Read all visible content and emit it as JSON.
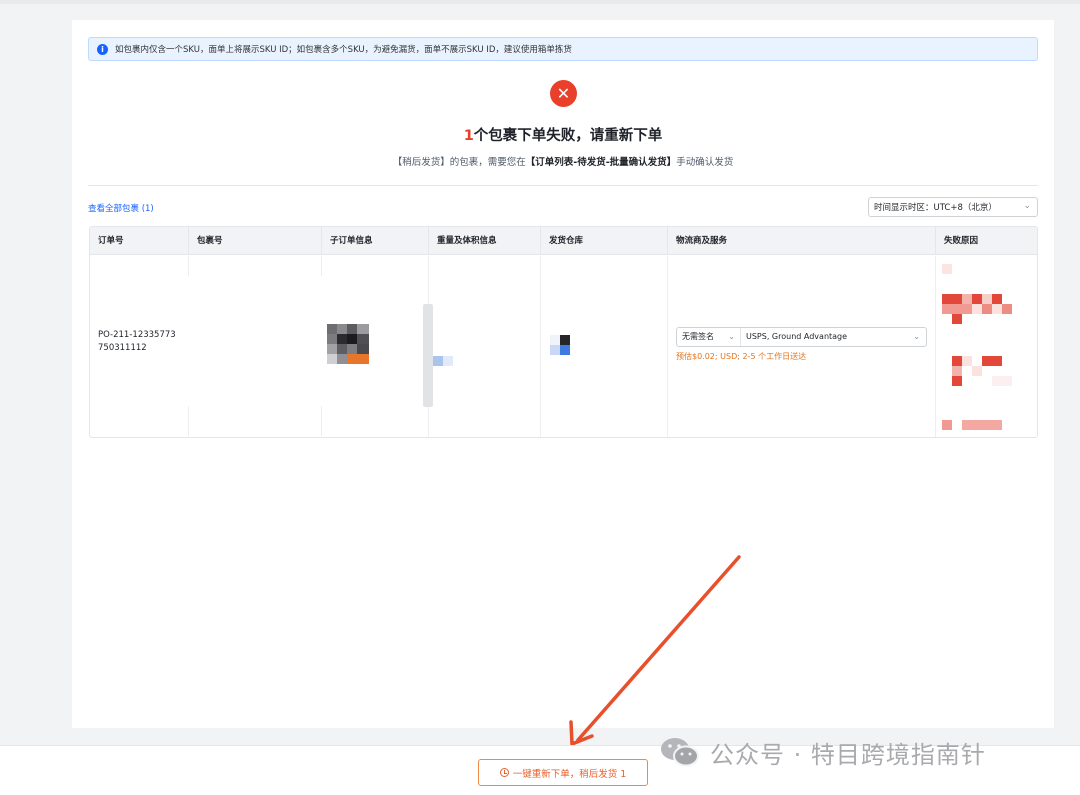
{
  "notice": {
    "text": "如包裹内仅含一个SKU，面单上将展示SKU ID；如包裹含多个SKU，为避免漏货，面单不展示SKU ID，建议使用箱单拣货"
  },
  "result": {
    "count": "1",
    "title_rest": "个包裹下单失败，请重新下单",
    "subtitle_pre": "【稍后发货】的包裹，需要您在",
    "subtitle_bold": "【订单列表-待发货-批量确认发货】",
    "subtitle_post": "手动确认发货"
  },
  "toolbar": {
    "view_all": "查看全部包裹 (1)",
    "timezone": "时间显示时区：UTC+8（北京）"
  },
  "table": {
    "headers": [
      "订单号",
      "包裹号",
      "子订单信息",
      "重量及体积信息",
      "发货仓库",
      "物流商及服务",
      "失败原因"
    ],
    "row": {
      "order_no": "PO-211-12335773750311112",
      "sign_option": "无需签名",
      "service": "USPS, Ground Advantage",
      "estimate": "预估$0.02; USD; 2-5 个工作日送达"
    }
  },
  "footer": {
    "retry_button": "一键重新下单，稍后发货 1"
  },
  "watermark": {
    "text": "公众号 · 特目跨境指南针"
  },
  "colors": {
    "error": "#e8402a",
    "link": "#1664ff",
    "warning": "#e37318",
    "button": "#e8602c"
  },
  "icons": {
    "info": "info-icon",
    "error": "close-circle-icon",
    "dropdown": "chevron-down-icon",
    "clock": "clock-icon",
    "wechat": "wechat-icon"
  }
}
